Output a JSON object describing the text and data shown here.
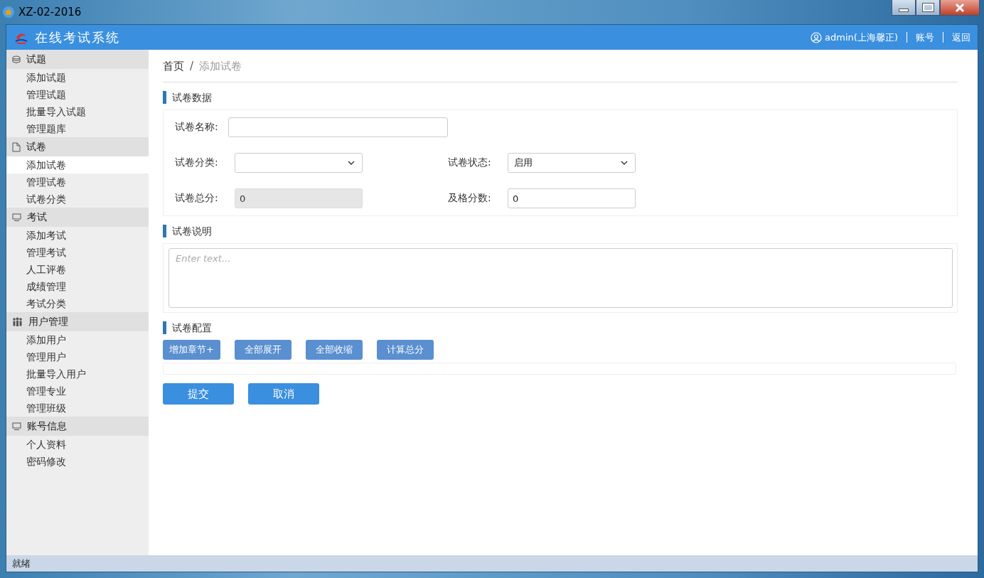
{
  "window": {
    "title": "XZ-02-2016"
  },
  "header": {
    "app_name": "在线考试系统",
    "user": "admin(上海馨正)",
    "links": [
      "账号",
      "返回"
    ]
  },
  "sidebar": {
    "groups": [
      {
        "kind": "database",
        "title": "试题",
        "items": [
          {
            "label": "添加试题",
            "selected": false
          },
          {
            "label": "管理试题",
            "selected": false
          },
          {
            "label": "批量导入试题",
            "selected": false
          },
          {
            "label": "管理题库",
            "selected": false
          }
        ]
      },
      {
        "kind": "file",
        "title": "试卷",
        "items": [
          {
            "label": "添加试卷",
            "selected": true
          },
          {
            "label": "管理试卷",
            "selected": false
          },
          {
            "label": "试卷分类",
            "selected": false
          }
        ]
      },
      {
        "kind": "monitor",
        "title": "考试",
        "items": [
          {
            "label": "添加考试",
            "selected": false
          },
          {
            "label": "管理考试",
            "selected": false
          },
          {
            "label": "人工评卷",
            "selected": false
          },
          {
            "label": "成绩管理",
            "selected": false
          },
          {
            "label": "考试分类",
            "selected": false
          }
        ]
      },
      {
        "kind": "users",
        "title": "用户管理",
        "items": [
          {
            "label": "添加用户",
            "selected": false
          },
          {
            "label": "管理用户",
            "selected": false
          },
          {
            "label": "批量导入用户",
            "selected": false
          },
          {
            "label": "管理专业",
            "selected": false
          },
          {
            "label": "管理班级",
            "selected": false
          }
        ]
      },
      {
        "kind": "monitor",
        "title": "账号信息",
        "items": [
          {
            "label": "个人资料",
            "selected": false
          },
          {
            "label": "密码修改",
            "selected": false
          }
        ]
      }
    ]
  },
  "breadcrumb": {
    "items": [
      "首页",
      "添加试卷"
    ],
    "separator": "/"
  },
  "sections": {
    "data": {
      "title": "试卷数据",
      "rows": [
        [
          {
            "label": "试卷名称:",
            "kind": "text",
            "disabled": false
          }
        ],
        [
          {
            "label": "试卷分类:",
            "kind": "select",
            "disabled": false
          },
          {
            "label": "试卷状态:",
            "kind": "select",
            "value": "启用",
            "disabled": false
          }
        ],
        [
          {
            "label": "试卷总分:",
            "kind": "text",
            "value": "0",
            "disabled": true
          },
          {
            "label": "及格分数:",
            "kind": "text",
            "value": "0",
            "disabled": false
          }
        ]
      ]
    },
    "description": {
      "title": "试卷说明",
      "placeholder": "Enter text..."
    },
    "config": {
      "title": "试卷配置",
      "buttons": [
        "增加章节+",
        "全部展开",
        "全部收缩",
        "计算总分"
      ]
    }
  },
  "actions": [
    "提交",
    "取消"
  ],
  "status_bar": "就绪"
}
